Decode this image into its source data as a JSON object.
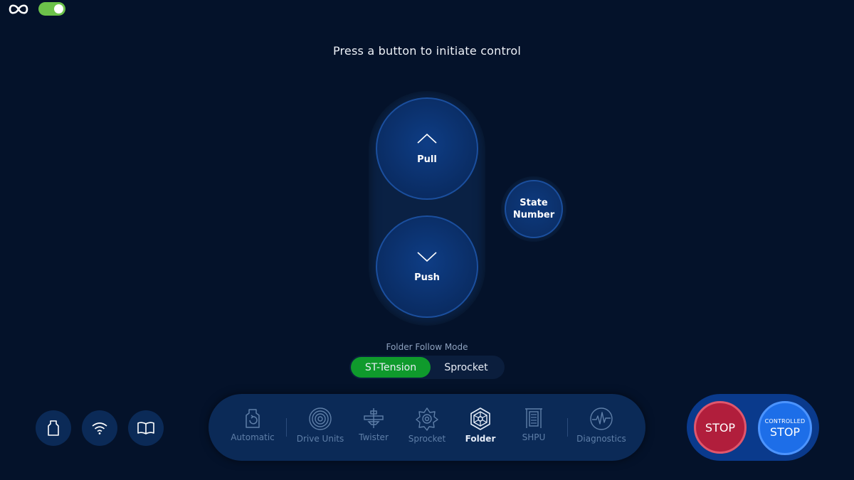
{
  "header": {
    "logo_icon": "infinity-icon",
    "toggle_on": true,
    "toggle_color": "#6cc24a"
  },
  "prompt": "Press a button to initiate control",
  "controls": {
    "pull_label": "Pull",
    "push_label": "Push",
    "state_line1": "State",
    "state_line2": "Number"
  },
  "follow_mode": {
    "label": "Folder Follow Mode",
    "options": [
      "ST-Tension",
      "Sprocket"
    ],
    "selected": "ST-Tension",
    "active_color": "#0f9a2c"
  },
  "quick_buttons": [
    {
      "icon": "bottle-icon"
    },
    {
      "icon": "wifi-icon"
    },
    {
      "icon": "book-icon"
    }
  ],
  "nav": {
    "items": [
      {
        "label": "Automatic",
        "icon": "automatic-icon"
      },
      {
        "label": "Drive Units",
        "icon": "drive-units-icon"
      },
      {
        "label": "Twister",
        "icon": "twister-icon"
      },
      {
        "label": "Sprocket",
        "icon": "sprocket-icon"
      },
      {
        "label": "Folder",
        "icon": "folder-icon"
      },
      {
        "label": "SHPU",
        "icon": "shpu-icon"
      },
      {
        "label": "Diagnostics",
        "icon": "diagnostics-icon"
      }
    ],
    "active": "Folder"
  },
  "stop": {
    "stop_label": "STOP",
    "controlled_small": "CONTROLLED",
    "controlled_big": "STOP",
    "stop_color": "#b11e3c",
    "controlled_color": "#1d6ee8"
  }
}
